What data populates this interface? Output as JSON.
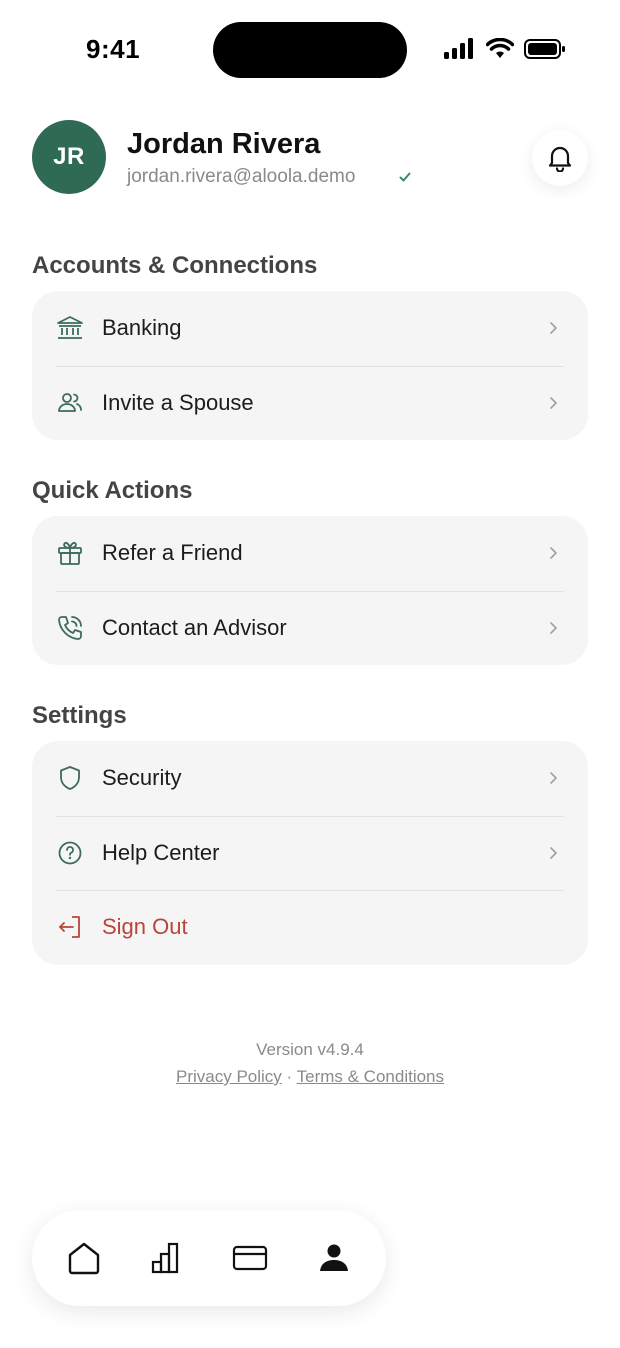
{
  "status_bar": {
    "time": "9:41"
  },
  "profile": {
    "initials": "JR",
    "name": "Jordan Rivera",
    "email": "jordan.rivera@aloola.demo",
    "avatar_color": "#2f6a55",
    "verified_icon": "check-icon",
    "notification_icon": "bell-icon"
  },
  "sections": [
    {
      "title": "Accounts & Connections",
      "items": [
        {
          "label": "Banking",
          "icon": "bank-icon"
        },
        {
          "label": "Invite a Spouse",
          "icon": "users-icon"
        }
      ]
    },
    {
      "title": "Quick Actions",
      "items": [
        {
          "label": "Refer a Friend",
          "icon": "gift-icon"
        },
        {
          "label": "Contact an Advisor",
          "icon": "phone-icon"
        }
      ]
    },
    {
      "title": "Settings",
      "items": [
        {
          "label": "Security",
          "icon": "shield-icon"
        },
        {
          "label": "Help Center",
          "icon": "help-icon"
        },
        {
          "label": "Sign Out",
          "icon": "sign-out-icon"
        }
      ]
    }
  ],
  "footer": {
    "version": "Version v4.9.4",
    "privacy_policy": "Privacy Policy",
    "separator": "·",
    "terms": "Terms & Conditions"
  },
  "tab_bar": {
    "tabs": [
      {
        "icon": "home-icon",
        "active": false
      },
      {
        "icon": "chart-icon",
        "active": false
      },
      {
        "icon": "card-icon",
        "active": false
      },
      {
        "icon": "profile-icon",
        "active": true
      }
    ]
  },
  "colors": {
    "accent": "#2f6a55",
    "icon_green": "#3d6b5b",
    "danger": "#b8453a",
    "card_bg": "#f5f5f5"
  }
}
